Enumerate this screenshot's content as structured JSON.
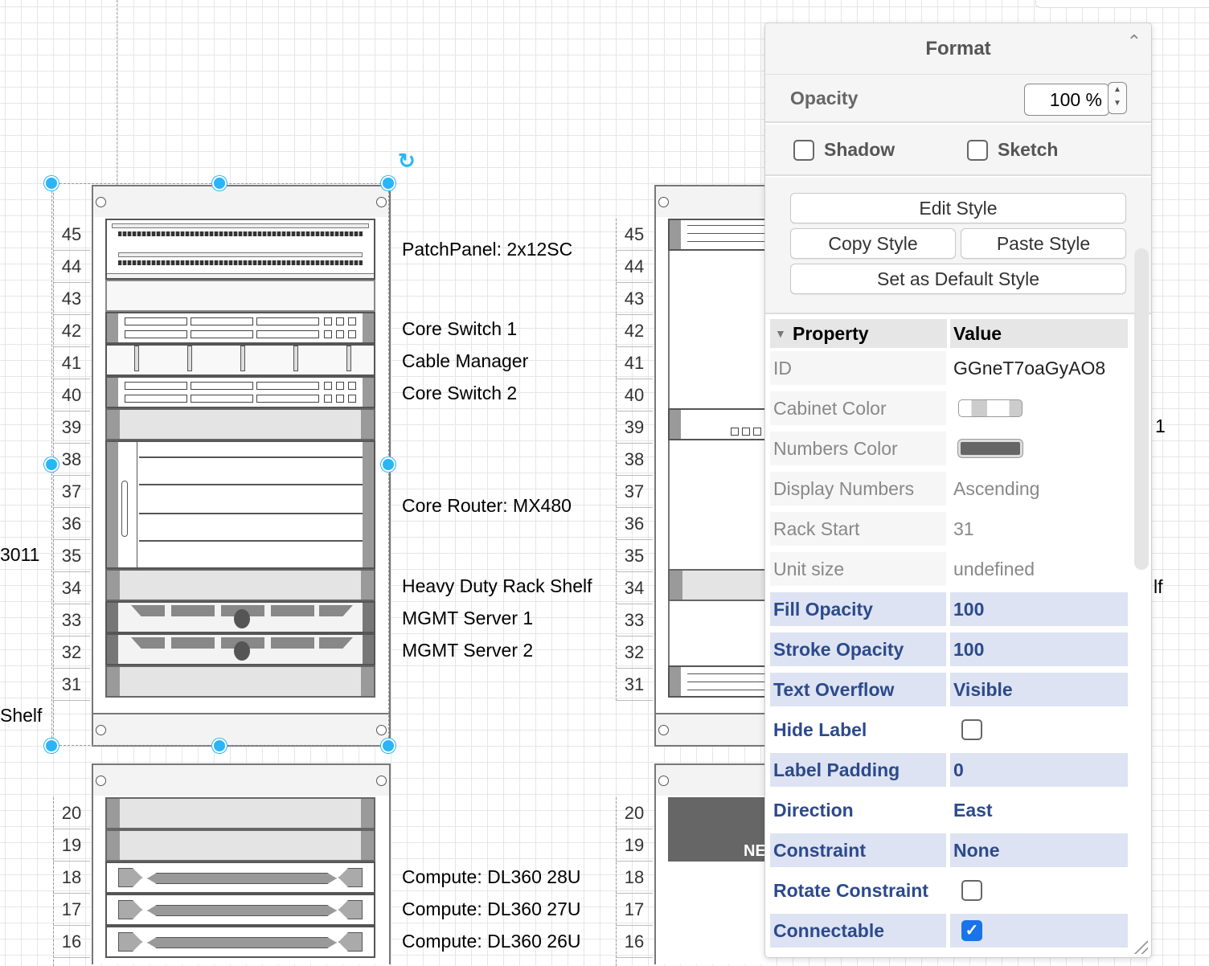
{
  "canvas": {
    "left_edge_labels": [
      "3011",
      "Shelf"
    ],
    "right_edge_labels": [
      "1",
      "lf"
    ]
  },
  "rack_left_top": {
    "numbers": [
      "45",
      "44",
      "43",
      "42",
      "41",
      "40",
      "39",
      "38",
      "37",
      "36",
      "35",
      "34",
      "33",
      "32",
      "31"
    ],
    "labels": {
      "patch_panel": "PatchPanel: 2x12SC",
      "core_switch_1": "Core Switch 1",
      "cable_manager": "Cable Manager",
      "core_switch_2": "Core Switch 2",
      "core_router": "Core Router: MX480",
      "rack_shelf": "Heavy Duty Rack Shelf",
      "mgmt_server_1": "MGMT Server 1",
      "mgmt_server_2": "MGMT Server 2"
    }
  },
  "rack_left_bottom": {
    "numbers": [
      "20",
      "19",
      "18",
      "17",
      "16"
    ],
    "labels": {
      "compute_28": "Compute: DL360 28U",
      "compute_27": "Compute: DL360 27U",
      "compute_26": "Compute: DL360 26U"
    }
  },
  "rack_right_top": {
    "numbers": [
      "45",
      "44",
      "43",
      "42",
      "41",
      "40",
      "39",
      "38",
      "37",
      "36",
      "35",
      "34",
      "33",
      "32",
      "31"
    ]
  },
  "rack_right_bottom": {
    "numbers": [
      "20",
      "19",
      "18",
      "17",
      "16"
    ],
    "device_text": "NE"
  },
  "format_panel": {
    "title": "Format",
    "opacity_label": "Opacity",
    "opacity_value": "100 %",
    "shadow_label": "Shadow",
    "sketch_label": "Sketch",
    "edit_style": "Edit Style",
    "copy_style": "Copy Style",
    "paste_style": "Paste Style",
    "set_default_style": "Set as Default Style",
    "property_header": "Property",
    "value_header": "Value",
    "properties": [
      {
        "key": "ID",
        "value": "GGneT7oaGyAO8"
      },
      {
        "key": "Cabinet Color",
        "value": ""
      },
      {
        "key": "Numbers Color",
        "value": ""
      },
      {
        "key": "Display Numbers",
        "value": "Ascending"
      },
      {
        "key": "Rack Start",
        "value": "31"
      },
      {
        "key": "Unit size",
        "value": "undefined"
      },
      {
        "key": "Fill Opacity",
        "value": "100"
      },
      {
        "key": "Stroke Opacity",
        "value": "100"
      },
      {
        "key": "Text Overflow",
        "value": "Visible"
      },
      {
        "key": "Hide Label",
        "value": ""
      },
      {
        "key": "Label Padding",
        "value": "0"
      },
      {
        "key": "Direction",
        "value": "East"
      },
      {
        "key": "Constraint",
        "value": "None"
      },
      {
        "key": "Rotate Constraint",
        "value": ""
      },
      {
        "key": "Connectable",
        "value": ""
      }
    ],
    "hide_label_checked": false,
    "rotate_constraint_checked": false,
    "connectable_checked": true,
    "colors": {
      "accent": "#29b6f6",
      "highlight_row": "#dde3f2",
      "highlight_text": "#2c4a8c",
      "checkbox_on": "#1a73e8"
    }
  }
}
